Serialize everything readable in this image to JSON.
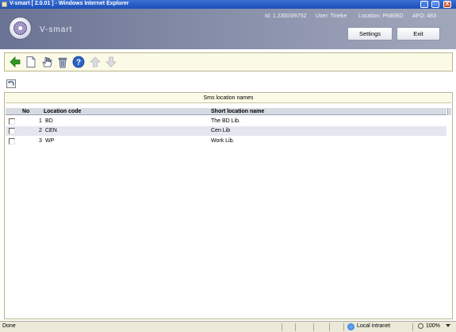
{
  "window": {
    "title": "V-smart [ 2.0.01 ] - Windows Internet Explorer",
    "minimize_glyph": "_",
    "maximize_glyph": "□",
    "close_glyph": "X"
  },
  "header": {
    "brand": "V-smart",
    "session": {
      "id": "Id: 1.23003/6752",
      "user": "User: Tineke",
      "location": "Location: PNB/BD",
      "afo": "AFO: 483"
    },
    "settings_label": "Settings",
    "exit_label": "Exit"
  },
  "toolbar": {
    "icons": [
      "back-arrow-icon",
      "new-document-icon",
      "select-hand-icon",
      "delete-bin-icon",
      "help-icon",
      "move-up-icon",
      "move-down-icon"
    ],
    "disabled": [
      "move-up-icon",
      "move-down-icon"
    ]
  },
  "panel": {
    "title": "Sms location names",
    "columns": {
      "no": "No",
      "location_code": "Location code",
      "short_name": "Short location name"
    },
    "rows": [
      {
        "no": "1",
        "code": "BD",
        "name": "The BD Lib."
      },
      {
        "no": "2",
        "code": "CEN",
        "name": "Cen Lib"
      },
      {
        "no": "3",
        "code": "WP",
        "name": "Work Lib."
      }
    ]
  },
  "statusbar": {
    "status": "Done",
    "zone": "Local intranet",
    "zoom": "100%"
  },
  "colors": {
    "header_gradient_start": "#6a7393",
    "toolbar_bg": "#fbfae6",
    "table_header_bg": "#d6dae3",
    "row_highlight": "#e4e7ef",
    "back_arrow": "#2e9a1f",
    "help_icon": "#2a63c9"
  }
}
